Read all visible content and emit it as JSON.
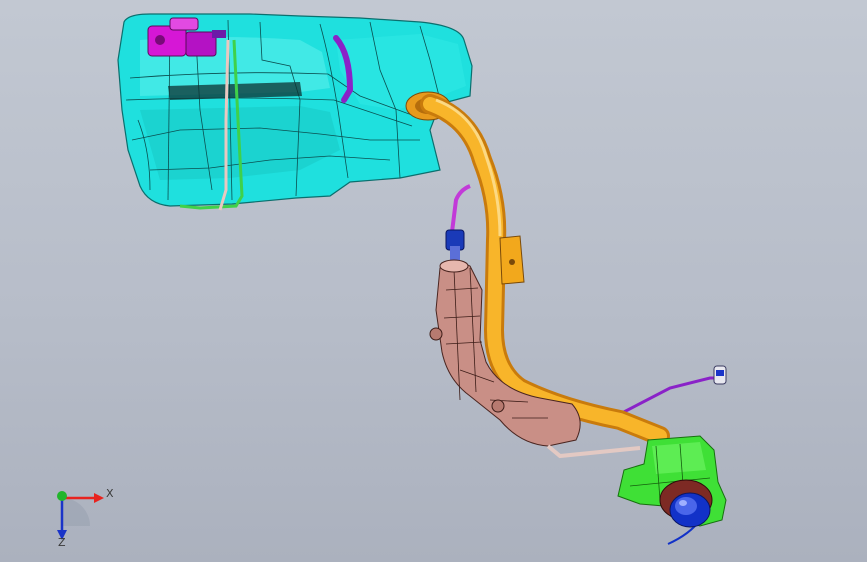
{
  "viewport": {
    "background_top": "#c2c8d2",
    "background_bottom": "#abb1be"
  },
  "model": {
    "parts": [
      {
        "name": "fuel-tank",
        "color": "#1fe0de"
      },
      {
        "name": "filler-pipe",
        "color": "#f5a623"
      },
      {
        "name": "filler-neck-shroud",
        "color": "#c98f86"
      },
      {
        "name": "fuel-door-housing",
        "color": "#3fe036"
      },
      {
        "name": "filler-cap",
        "color": "#1232c8"
      },
      {
        "name": "vent-lines",
        "color": "#c23ad8"
      },
      {
        "name": "sender-unit",
        "color": "#d617d6"
      },
      {
        "name": "mounting-bracket",
        "color": "#f2a81c"
      }
    ]
  },
  "triad": {
    "x_label": "X",
    "z_label": "Z",
    "x_color": "#e8231f",
    "y_color": "#21b52b",
    "z_color": "#1a34c8"
  }
}
